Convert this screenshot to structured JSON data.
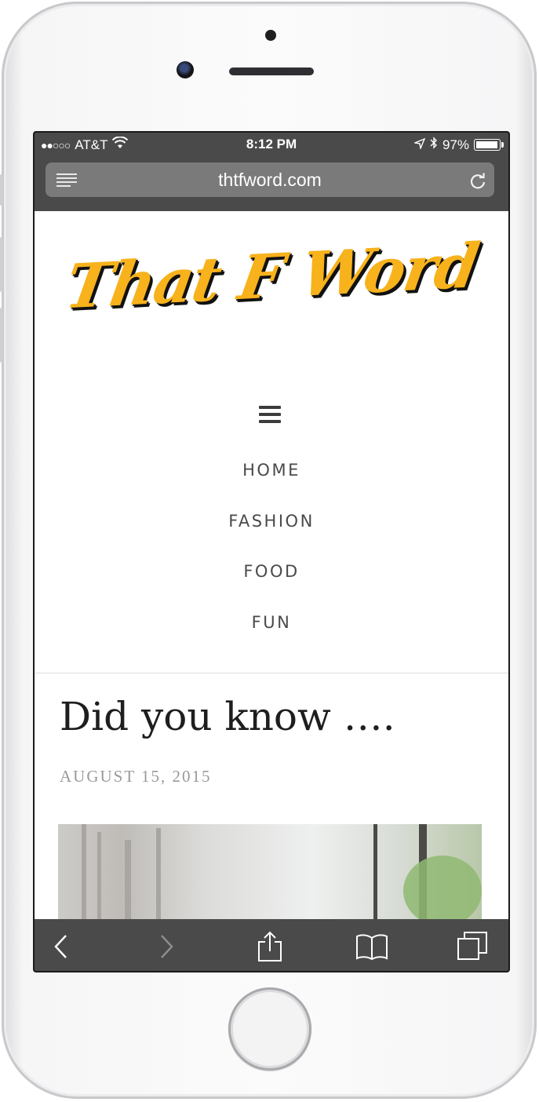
{
  "status_bar": {
    "carrier": "AT&T",
    "signal": "●●○○○",
    "time": "8:12 PM",
    "battery": "97%",
    "battery_level": 0.97
  },
  "browser": {
    "url": "thtfword.com"
  },
  "site": {
    "logo_text": "That F Word",
    "nav_items": [
      "HOME",
      "FASHION",
      "FOOD",
      "FUN"
    ]
  },
  "post": {
    "title": "Did you know ….",
    "date": "AUGUST 15, 2015"
  },
  "icons": {
    "wifi": "wifi-icon",
    "location": "location-arrow-icon",
    "bluetooth": "bluetooth-icon",
    "reader": "reader-icon",
    "reload": "reload-icon",
    "menu": "hamburger-menu-icon",
    "back": "back-chevron-icon",
    "forward": "forward-chevron-icon",
    "share": "share-icon",
    "bookmarks": "bookmarks-icon",
    "tabs": "tabs-icon"
  },
  "colors": {
    "logo": "#f7b21c",
    "browser_chrome": "#4a4a4a"
  }
}
